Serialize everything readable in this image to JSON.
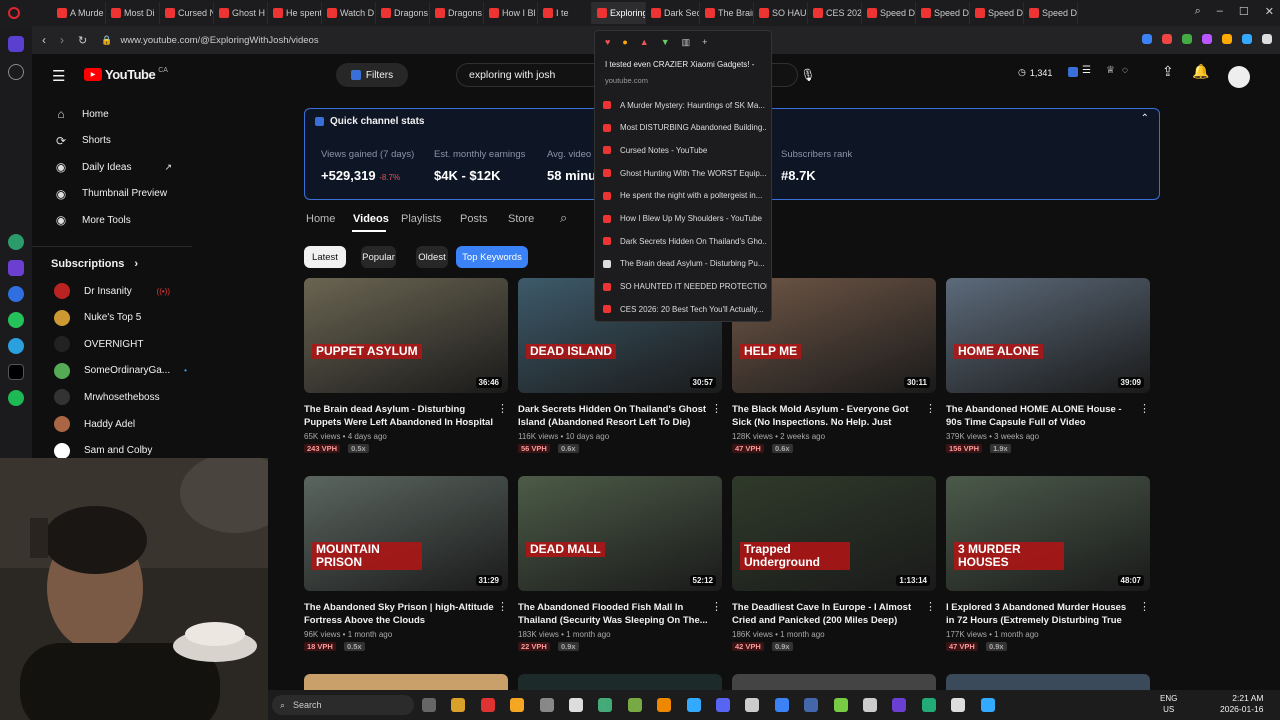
{
  "browser": {
    "tabs": [
      "A Murde",
      "Most Di",
      "Cursed N",
      "Ghost H",
      "He spent",
      "Watch D",
      "Dragons",
      "Dragons",
      "How I Bl",
      "I te",
      "Exploring With",
      "Dark Sec",
      "The Brain",
      "SO HAUN",
      "CES 202",
      "Speed D",
      "Speed D",
      "Speed D",
      "Speed D"
    ],
    "url": "www.youtube.com/@ExploringWithJosh/videos"
  },
  "header": {
    "logo": "YouTube",
    "country": "CA",
    "filters": "Filters",
    "search_value": "exploring with josh",
    "counter": "1,341"
  },
  "sidebar": {
    "items": [
      {
        "label": "Home",
        "icon": "home-icon"
      },
      {
        "label": "Shorts",
        "icon": "shorts-icon"
      },
      {
        "label": "Daily Ideas",
        "icon": "ideas-icon"
      },
      {
        "label": "Thumbnail Preview",
        "icon": "thumbnail-icon"
      },
      {
        "label": "More Tools",
        "icon": "tools-icon"
      }
    ],
    "subs_title": "Subscriptions",
    "subs": [
      {
        "label": "Dr Insanity",
        "color": "#b22"
      },
      {
        "label": "Nuke's Top 5",
        "color": "#c93"
      },
      {
        "label": "OVERNIGHT",
        "color": "#222"
      },
      {
        "label": "SomeOrdinaryGa...",
        "color": "#5a5"
      },
      {
        "label": "Mrwhosetheboss",
        "color": "#333"
      },
      {
        "label": "Haddy Adel",
        "color": "#a64"
      },
      {
        "label": "Sam and Colby",
        "color": "#fff"
      }
    ]
  },
  "stats": {
    "title": "Quick channel stats",
    "items": [
      {
        "label": "Views gained (7 days)",
        "value": "+529,319",
        "delta": "-8.7%"
      },
      {
        "label": "Est. monthly earnings",
        "value": "$4K - $12K"
      },
      {
        "label": "Avg. video",
        "value": "58 minu"
      },
      {
        "label": "Subscribers rank",
        "value": "#8.7K"
      }
    ]
  },
  "channel_tabs": [
    "Home",
    "Videos",
    "Playlists",
    "Posts",
    "Store"
  ],
  "chips": [
    "Latest",
    "Popular",
    "Oldest",
    "Top Keywords"
  ],
  "videos": [
    {
      "title": "The Brain dead Asylum - Disturbing Puppets Were Left Abandoned In Hospital Beds",
      "meta": "65K views • 4 days ago",
      "vph": "243 VPH",
      "ratio": "0.5x",
      "duration": "36:46",
      "bg": "#6a6552",
      "overlay": "PUPPET ASYLUM"
    },
    {
      "title": "Dark Secrets Hidden On Thailand's Ghost Island (Abandoned Resort Left To Die)",
      "meta": "116K views • 10 days ago",
      "vph": "56 VPH",
      "ratio": "0.6x",
      "duration": "30:57",
      "bg": "#3d5a6a",
      "overlay": "DEAD ISLAND"
    },
    {
      "title": "The Black Mold Asylum - Everyone Got Sick (No Inspections. No Help. Just death)",
      "meta": "128K views • 2 weeks ago",
      "vph": "47 VPH",
      "ratio": "0.6x",
      "duration": "30:11",
      "bg": "#6e5646",
      "overlay": "HELP ME"
    },
    {
      "title": "The Abandoned HOME ALONE House - 90s Time Capsule Full of Video Games,VHS an...",
      "meta": "379K views • 3 weeks ago",
      "vph": "156 VPH",
      "ratio": "1.9x",
      "duration": "39:09",
      "bg": "#5c6a7a",
      "overlay": "HOME ALONE"
    },
    {
      "title": "The Abandoned Sky Prison | high-Altitude Fortress Above the Clouds",
      "meta": "96K views • 1 month ago",
      "vph": "18 VPH",
      "ratio": "0.5x",
      "duration": "31:29",
      "bg": "#5b6660",
      "overlay": "MOUNTAIN PRISON"
    },
    {
      "title": "The Abandoned Flooded Fish Mall In Thailand (Security Was Sleeping On The...",
      "meta": "183K views • 1 month ago",
      "vph": "22 VPH",
      "ratio": "0.9x",
      "duration": "52:12",
      "bg": "#4c5b47",
      "overlay": "DEAD MALL"
    },
    {
      "title": "The Deadliest Cave In Europe - I Almost Cried and Panicked (200 Miles Deep)",
      "meta": "186K views • 1 month ago",
      "vph": "42 VPH",
      "ratio": "0.9x",
      "duration": "1:13:14",
      "bg": "#2f3a2a",
      "overlay": "Trapped Underground"
    },
    {
      "title": "I Explored 3 Abandoned Murder Houses in 72 Hours (Extremely Disturbing True Crime)",
      "meta": "177K views • 1 month ago",
      "vph": "47 VPH",
      "ratio": "0.9x",
      "duration": "48:07",
      "bg": "#4b5a4a",
      "overlay": "3 MURDER HOUSES"
    }
  ],
  "dropdown": {
    "header": "I tested even CRAZIER Xiaomi Gadgets! -",
    "domain": "youtube.com",
    "items": [
      "A Murder Mystery: Hauntings of SK Ma...",
      "Most DISTURBING Abandoned Building...",
      "Cursed Notes - YouTube",
      "Ghost Hunting With The WORST Equip...",
      "He spent the night with a poltergeist in...",
      "How I Blew Up My Shoulders - YouTube",
      "Dark Secrets Hidden On Thailand's Gho...",
      "The Brain dead Asylum - Disturbing Pu...",
      "SO HAUNTED IT NEEDED PROTECTION...",
      "CES 2026: 20 Best Tech You'll Actually..."
    ]
  },
  "taskbar": {
    "search": "Search",
    "lang": "ENG",
    "region": "US",
    "time": "2:21 AM",
    "date": "2026-01-16"
  },
  "colors": {
    "accent": "#3b6fd8",
    "yt_red": "#ff0000",
    "negative": "#e05555"
  }
}
